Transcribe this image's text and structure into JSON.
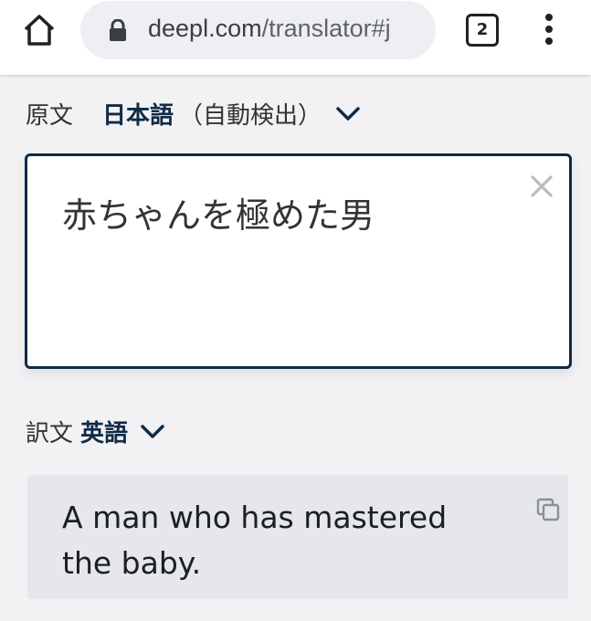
{
  "browser": {
    "url_main": "deepl.com",
    "url_rest": "/translator#j",
    "tab_count": "2"
  },
  "source": {
    "prefix": "原文",
    "language": "日本語",
    "detect": "（自動検出）",
    "text": "赤ちゃんを極めた男"
  },
  "target": {
    "prefix": "訳文",
    "language": "英語",
    "text_line1": "A man who has mastered",
    "text_line2": "the baby."
  }
}
